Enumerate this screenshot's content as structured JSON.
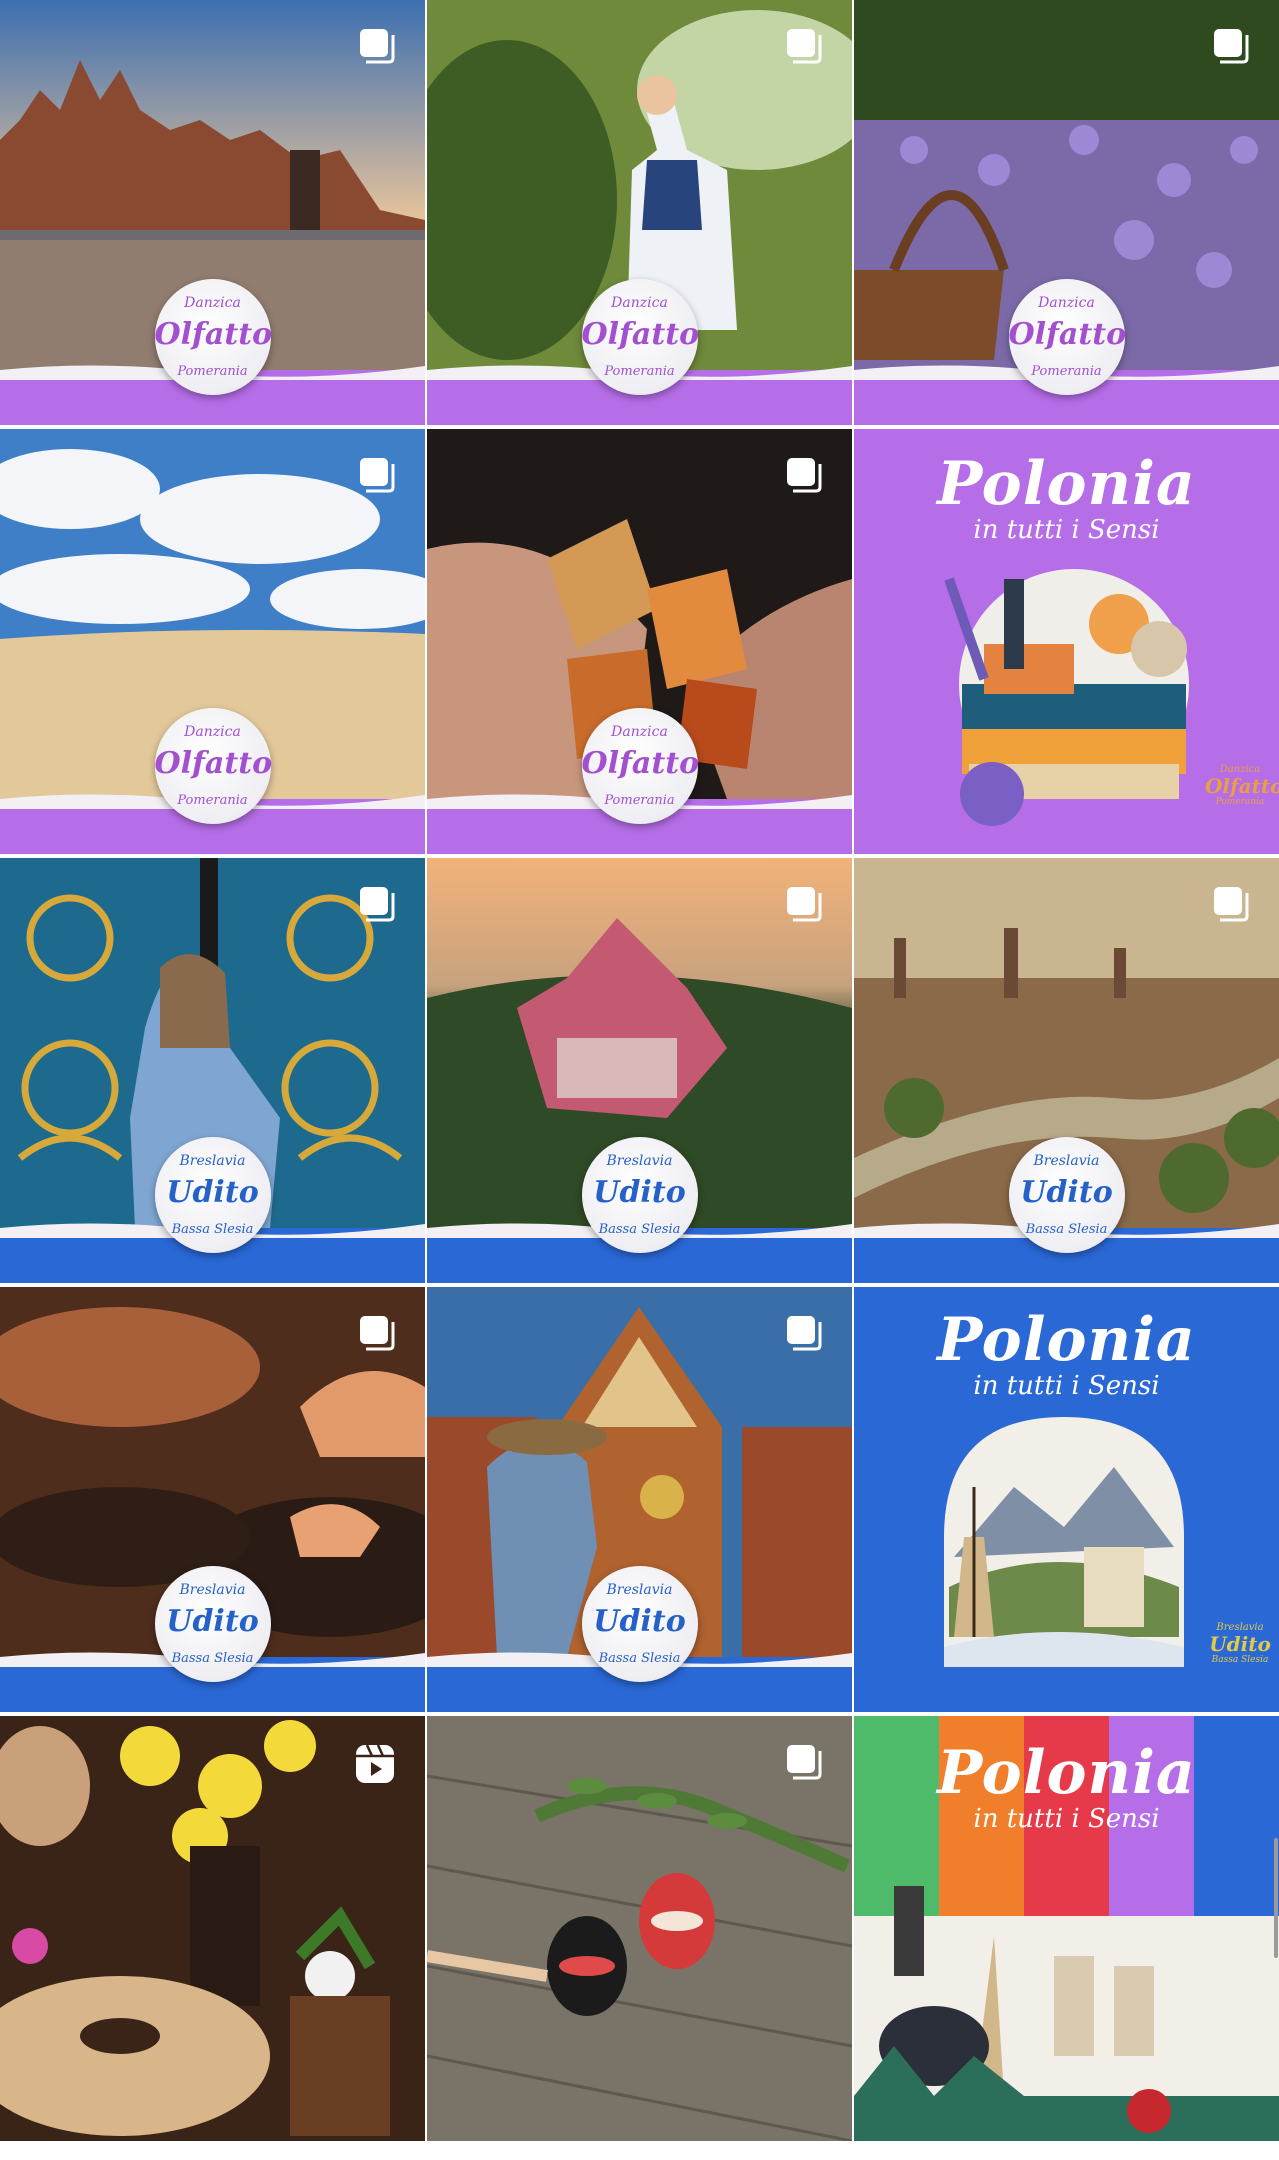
{
  "feed": {
    "name": "profile-post-grid",
    "colors": {
      "smell": "#b66ee8",
      "hearing": "#2a68d6",
      "badge_text_smell": "#a24fd0",
      "badge_text_hearing": "#2561c9"
    },
    "badges": {
      "smell": {
        "top": "Danzica",
        "main": "Olfatto",
        "bottom": "Pomerania"
      },
      "hearing": {
        "top": "Breslavia",
        "main": "Udito",
        "bottom": "Bassa Slesia"
      }
    },
    "poster": {
      "title": "Polonia",
      "subtitle": "in tutti i Sensi"
    },
    "posts": [
      {
        "subject": "gdansk-harbour-sunset",
        "type": "carousel-icon"
      },
      {
        "subject": "woman-folk-costume",
        "type": "carousel-icon"
      },
      {
        "subject": "lavender-basket",
        "type": "carousel-icon"
      },
      {
        "subject": "sand-dunes-clouds",
        "type": "carousel-icon"
      },
      {
        "subject": "amber-stones-hands",
        "type": "carousel-icon"
      },
      {
        "subject": "polonia-poster-smell",
        "type": "none"
      },
      {
        "subject": "woman-golden-gate",
        "type": "carousel-icon"
      },
      {
        "subject": "castle-aerial-sunset",
        "type": "carousel-icon"
      },
      {
        "subject": "city-river-aerial",
        "type": "carousel-icon"
      },
      {
        "subject": "hands-bowls",
        "type": "carousel-icon"
      },
      {
        "subject": "woman-town-hall",
        "type": "carousel-icon"
      },
      {
        "subject": "polonia-poster-hearing",
        "type": "none"
      },
      {
        "subject": "easter-cake-daffodils",
        "type": "reel-icon"
      },
      {
        "subject": "painted-easter-eggs",
        "type": "carousel-icon"
      },
      {
        "subject": "polonia-poster-all-senses",
        "type": "none"
      }
    ]
  }
}
